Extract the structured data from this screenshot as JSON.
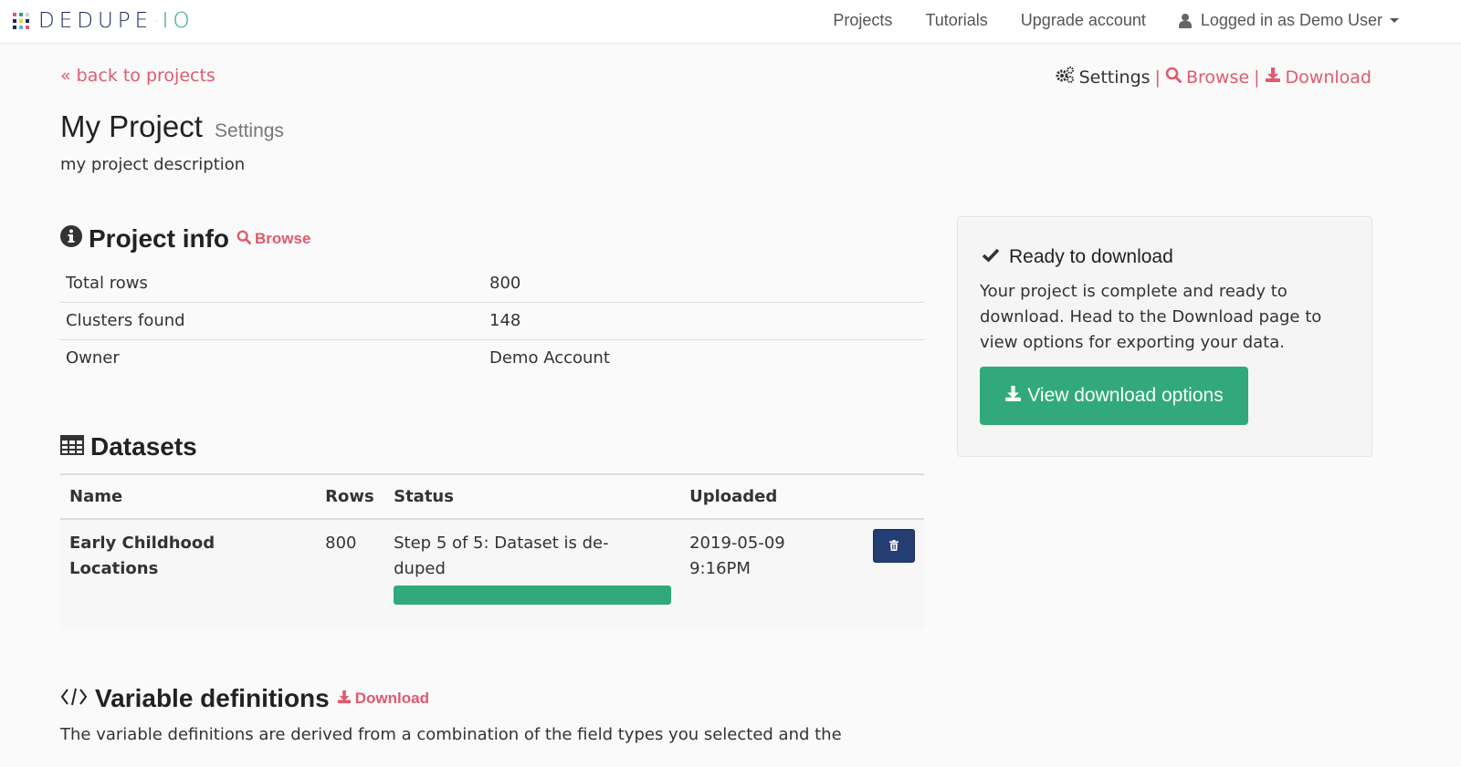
{
  "brand": {
    "name_left": "DEDUPE",
    "separator": "·",
    "name_right": "IO",
    "dot_colors": [
      "#e05a6e",
      "#2aa676",
      "#c8d4e6",
      "#1b2a5c",
      "#f2c94c",
      "#1b2a5c",
      "#1b2a5c",
      "#6aaee8",
      "#e05a6e"
    ]
  },
  "nav": {
    "items": [
      {
        "label": "Projects"
      },
      {
        "label": "Tutorials"
      },
      {
        "label": "Upgrade account"
      }
    ],
    "user_label": "Logged in as Demo User",
    "user_icon": "user-icon",
    "caret_icon": "caret-down-icon"
  },
  "top": {
    "back_label": "« back to projects",
    "actions": {
      "settings": "Settings",
      "settings_icon": "gears-icon",
      "separator": "|",
      "browse": "Browse",
      "browse_icon": "search-icon",
      "download": "Download",
      "download_icon": "download-icon"
    }
  },
  "project": {
    "title": "My Project",
    "subtitle": "Settings",
    "description": "my project description"
  },
  "project_info": {
    "heading": "Project info",
    "icon": "info-circle-icon",
    "browse_label": "Browse",
    "rows": [
      {
        "label": "Total rows",
        "value": "800"
      },
      {
        "label": "Clusters found",
        "value": "148"
      },
      {
        "label": "Owner",
        "value": "Demo Account"
      }
    ]
  },
  "datasets": {
    "heading": "Datasets",
    "icon": "table-icon",
    "columns": [
      "Name",
      "Rows",
      "Status",
      "Uploaded"
    ],
    "rows": [
      {
        "name": "Early Childhood Locations",
        "rows": "800",
        "status": "Step 5 of 5: Dataset is de-duped",
        "progress_percent": 100,
        "uploaded_date": "2019-05-09",
        "uploaded_time": "9:16PM",
        "delete_icon": "trash-icon"
      }
    ]
  },
  "ready_panel": {
    "title": "Ready to download",
    "icon": "check-icon",
    "text": "Your project is complete and ready to download. Head to the Download page to view options for exporting your data.",
    "button_label": "View download options",
    "button_icon": "download-icon"
  },
  "variables": {
    "heading": "Variable definitions",
    "icon": "code-icon",
    "download_label": "Download",
    "description": "The variable definitions are derived from a combination of the field types you selected and the"
  },
  "colors": {
    "accent_pink": "#e05a6e",
    "success_green": "#31a97c",
    "navy": "#243d72"
  }
}
